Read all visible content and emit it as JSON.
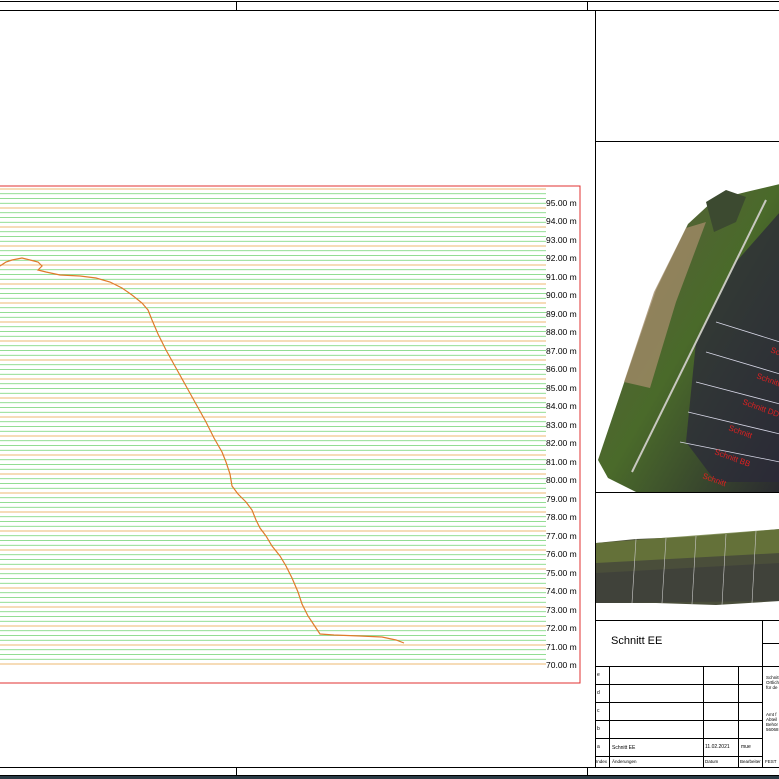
{
  "drawing": {
    "type": "cross-section",
    "section_title": "Schnitt EE",
    "y_axis": {
      "ticks": [
        "95.00 m",
        "94.00 m",
        "93.00 m",
        "92.00 m",
        "91.00 m",
        "90.00 m",
        "89.00 m",
        "88.00 m",
        "87.00 m",
        "86.00 m",
        "85.00 m",
        "84.00 m",
        "83.00 m",
        "82.00 m",
        "81.00 m",
        "80.00 m",
        "79.00 m",
        "78.00 m",
        "77.00 m",
        "76.00 m",
        "75.00 m",
        "74.00 m",
        "73.00 m",
        "72.00 m",
        "71.00 m",
        "70.00 m"
      ],
      "min": 70,
      "max": 95
    },
    "colors": {
      "grid_major": "#e8a040",
      "grid_minor": "#6fd26f",
      "frame": "#e03030",
      "profile": "#e07a2a",
      "label": "#e02020"
    }
  },
  "map_labels": [
    "Schnitt",
    "Schnitt",
    "Schnitt DD",
    "Schnitt",
    "Schnitt BB",
    "Schnitt"
  ],
  "title_block": {
    "revision_rows": [
      {
        "index": "e",
        "change": "",
        "date": "",
        "by": ""
      },
      {
        "index": "d",
        "change": "",
        "date": "",
        "by": ""
      },
      {
        "index": "c",
        "change": "",
        "date": "",
        "by": ""
      },
      {
        "index": "b",
        "change": "",
        "date": "",
        "by": ""
      },
      {
        "index": "a",
        "change": "Schnitt EE",
        "date": "11.02.2021",
        "by": "mue"
      }
    ],
    "headers": {
      "index": "Index",
      "change": "Änderungen",
      "date": "Datum",
      "by": "Bearbeiter"
    },
    "status": "FEST",
    "side_notes": [
      "Schnitt",
      "Ortlich",
      "für de",
      "Amt f",
      "Abteil",
      "Behör",
      "56068"
    ]
  }
}
